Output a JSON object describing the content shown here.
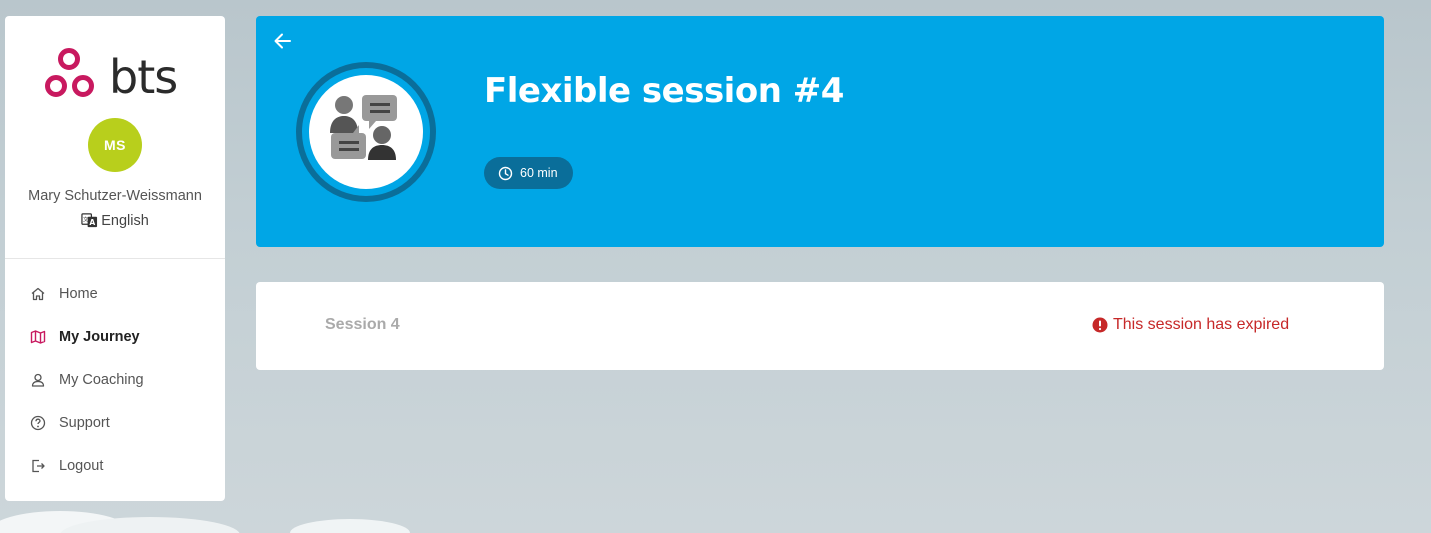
{
  "sidebar": {
    "logo_text": "bts",
    "avatar_initials": "MS",
    "user_name": "Mary Schutzer-Weissmann",
    "language": "English",
    "items": [
      {
        "label": "Home",
        "icon": "home-icon"
      },
      {
        "label": "My Journey",
        "icon": "map-icon",
        "active": true
      },
      {
        "label": "My Coaching",
        "icon": "user-icon"
      },
      {
        "label": "Support",
        "icon": "help-circle-icon"
      },
      {
        "label": "Logout",
        "icon": "logout-icon"
      }
    ]
  },
  "header": {
    "title": "Flexible session #4",
    "duration": "60 min"
  },
  "session_card": {
    "title": "Session 4",
    "status": "This session has expired"
  },
  "colors": {
    "brand_pink": "#c8195f",
    "banner_blue": "#00a6e6",
    "avatar_green": "#b8cf1c",
    "expired_red": "#c62828"
  }
}
